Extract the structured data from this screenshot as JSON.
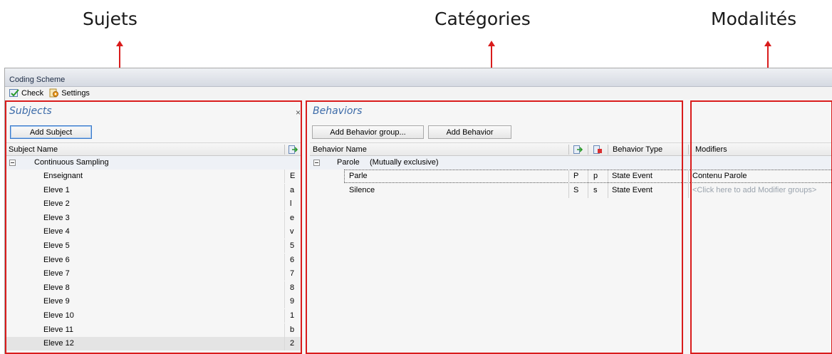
{
  "annotations": {
    "sujets": "Sujets",
    "categories": "Catégories",
    "modalites": "Modalités"
  },
  "window": {
    "title": "Coding Scheme",
    "toolbar": {
      "check_label": "Check",
      "settings_label": "Settings"
    }
  },
  "subjects": {
    "title": "Subjects",
    "close_glyph": "×",
    "add_button": "Add Subject",
    "col_name": "Subject Name",
    "group": "Continuous Sampling",
    "items": [
      {
        "name": "Enseignant",
        "key": "E"
      },
      {
        "name": "Eleve 1",
        "key": "a"
      },
      {
        "name": "Eleve 2",
        "key": "l"
      },
      {
        "name": "Eleve 3",
        "key": "e"
      },
      {
        "name": "Eleve 4",
        "key": "v"
      },
      {
        "name": "Eleve 5",
        "key": "5"
      },
      {
        "name": "Eleve 6",
        "key": "6"
      },
      {
        "name": "Eleve 7",
        "key": "7"
      },
      {
        "name": "Eleve 8",
        "key": "8"
      },
      {
        "name": "Eleve 9",
        "key": "9"
      },
      {
        "name": "Eleve 10",
        "key": "1"
      },
      {
        "name": "Eleve 11",
        "key": "b"
      },
      {
        "name": "Eleve 12",
        "key": "2"
      }
    ]
  },
  "behaviors": {
    "title": "Behaviors",
    "add_group_button": "Add Behavior group...",
    "add_button": "Add Behavior",
    "col_name": "Behavior Name",
    "col_type": "Behavior Type",
    "group_name": "Parole",
    "group_note": "(Mutually exclusive)",
    "items": [
      {
        "name": "Parle",
        "start": "P",
        "stop": "p",
        "type": "State Event"
      },
      {
        "name": "Silence",
        "start": "S",
        "stop": "s",
        "type": "State Event"
      }
    ]
  },
  "modifiers": {
    "col_name": "Modifiers",
    "values": [
      "Contenu Parole",
      "<Click here to add Modifier groups>"
    ]
  },
  "colors": {
    "annotation_red": "#d91c1c",
    "panel_title_blue": "#3b6aa8"
  }
}
